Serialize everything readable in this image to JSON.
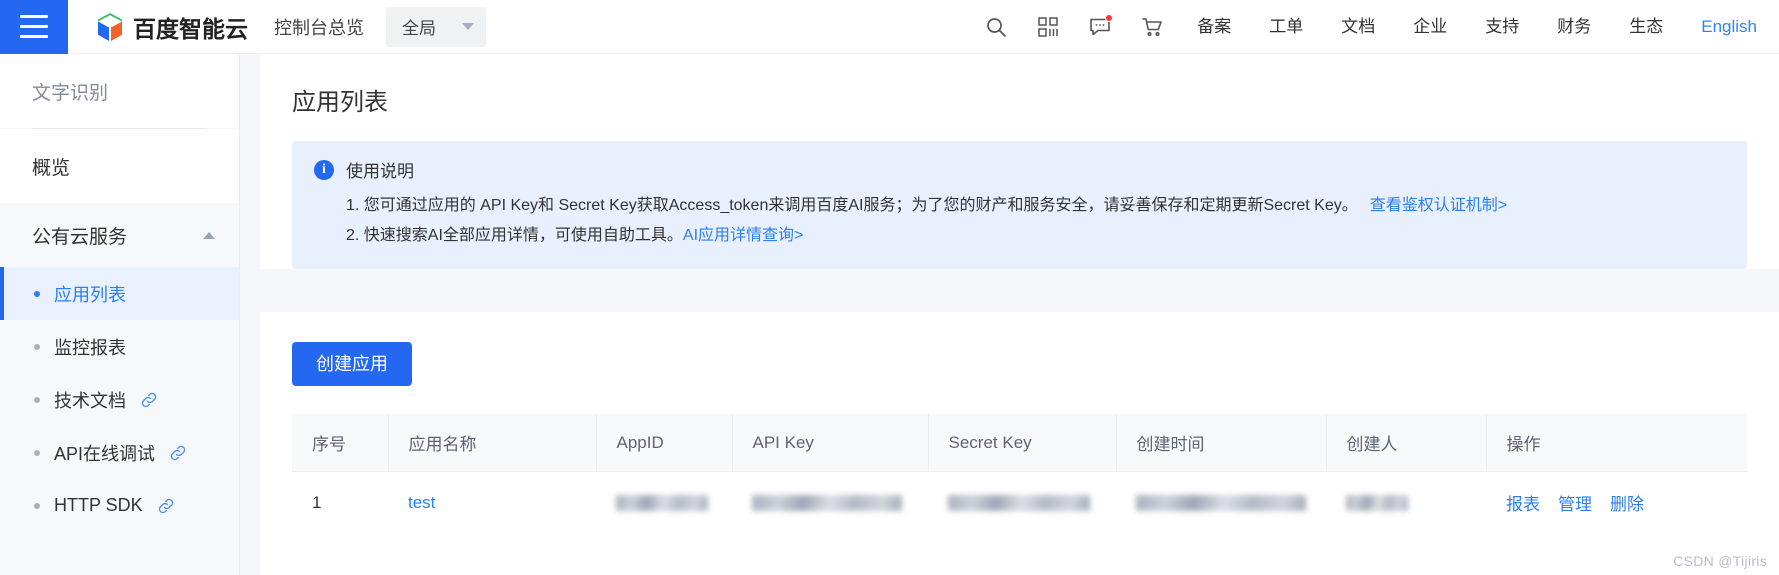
{
  "header": {
    "menu_icon": "hamburger-icon",
    "brand_text": "百度智能云",
    "console_title": "控制台总览",
    "region": {
      "label": "全局",
      "caret_icon": "chevron-down-icon"
    },
    "icons": [
      {
        "name": "search-icon",
        "glyph": "search"
      },
      {
        "name": "apps-grid-icon",
        "glyph": "grid"
      },
      {
        "name": "message-icon",
        "glyph": "message",
        "badge": true
      },
      {
        "name": "cart-icon",
        "glyph": "cart"
      }
    ],
    "links": [
      "备案",
      "工单",
      "文档",
      "企业",
      "支持",
      "财务",
      "生态"
    ],
    "language": "English"
  },
  "sidebar": {
    "module_name": "文字识别",
    "overview": "概览",
    "group": {
      "label": "公有云服务",
      "caret_icon": "chevron-up-icon"
    },
    "items": [
      {
        "label": "应用列表",
        "active": true,
        "external": false
      },
      {
        "label": "监控报表",
        "active": false,
        "external": false
      },
      {
        "label": "技术文档",
        "active": false,
        "external": true
      },
      {
        "label": "API在线调试",
        "active": false,
        "external": true
      },
      {
        "label": "HTTP SDK",
        "active": false,
        "external": true
      }
    ]
  },
  "main": {
    "page_title": "应用列表",
    "notice": {
      "icon": "info-icon",
      "heading": "使用说明",
      "line1_text": "1. 您可通过应用的 API Key和 Secret Key获取Access_token来调用百度AI服务；为了您的财产和服务安全，请妥善保存和定期更新Secret Key。",
      "line1_link": "查看鉴权认证机制>",
      "line2_text": "2. 快速搜索AI全部应用详情，可使用自助工具。",
      "line2_link": "AI应用详情查询>"
    },
    "create_button": "创建应用",
    "table": {
      "columns": [
        "序号",
        "应用名称",
        "AppID",
        "API Key",
        "Secret Key",
        "创建时间",
        "创建人",
        "操作"
      ],
      "rows": [
        {
          "index": "1",
          "app_name": "test",
          "app_id": "",
          "api_key": "",
          "secret_key": "",
          "created_at": "",
          "creator": "",
          "actions": [
            "报表",
            "管理",
            "删除"
          ]
        }
      ]
    }
  },
  "watermark": "CSDN @Tijiris",
  "colors": {
    "brand_blue": "#2468f2",
    "link_blue": "#2b7ff0",
    "notice_bg": "#e8effd",
    "sidebar_bg": "#f6f8fb",
    "active_bg": "#eaf1fe",
    "badge_red": "#f33"
  }
}
